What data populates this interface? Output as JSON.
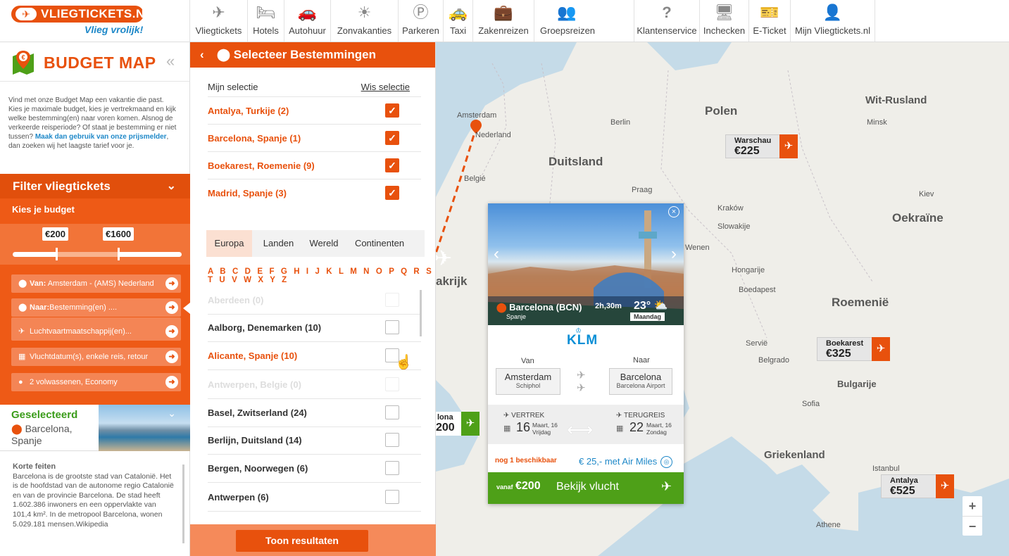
{
  "brand": {
    "name": "VLIEGTICKETS.NL",
    "slogan": "Vlieg vrolijk!"
  },
  "nav": [
    {
      "label": "Vliegtickets",
      "icon": "plane-icon"
    },
    {
      "label": "Hotels",
      "icon": "bed-icon"
    },
    {
      "label": "Autohuur",
      "icon": "car-icon"
    },
    {
      "label": "Zonvakanties",
      "icon": "sun-icon"
    },
    {
      "label": "Parkeren",
      "icon": "parking-icon"
    },
    {
      "label": "Taxi",
      "icon": "taxi-icon"
    },
    {
      "label": "Zakenreizen",
      "icon": "briefcase-icon"
    },
    {
      "label": "Groepsreizen",
      "icon": "group-icon"
    },
    {
      "label": "Klantenservice",
      "icon": "question-icon"
    },
    {
      "label": "Inchecken",
      "icon": "monitor-check-icon"
    },
    {
      "label": "E-Ticket",
      "icon": "ticket-icon"
    },
    {
      "label": "Mijn Vliegtickets.nl",
      "icon": "user-icon"
    }
  ],
  "budget_map": {
    "title": "BUDGET MAP",
    "intro": "Vind met onze Budget Map een vakantie die past. Kies je maximale budget, kies je vertrekmaand en kijk welke bestemming(en) naar voren komen. Alsnog de verkeerde reisperiode? Of staat je bestemming er niet tussen?",
    "intro_link": "Maak dan gebruik van onze prijsmelder",
    "intro_end": ", dan zoeken wij het laagste tarief voor je."
  },
  "filter": {
    "title": "Filter vliegtickets",
    "budget_label": "Kies je budget",
    "min_price": "€200",
    "max_price": "€1600",
    "van_label": "Van:",
    "van_value": "Amsterdam - (AMS) Nederland",
    "naar_label": "Naar:",
    "naar_value": "Bestemming(en) ....",
    "airlines": "Luchtvaartmaatschappij(en)...",
    "dates": "Vluchtdatum(s), enkele reis, retour",
    "passengers": "2 volwassenen, Economy"
  },
  "selected": {
    "title": "Geselecteerd",
    "place": "Barcelona, Spanje"
  },
  "facts": {
    "title": "Korte feiten",
    "text": "Barcelona is de grootste stad van Catalonië. Het is de hoofdstad van de autonome regio Catalonië en van de provincie Barcelona. De stad heeft 1.602.386 inwoners en een oppervlakte van 101,4 km². In de metropool Barcelona, wonen 5.029.181 mensen.Wikipedia"
  },
  "destinations": {
    "title": "Selecteer Bestemmingen",
    "my_selection": "Mijn selectie",
    "clear": "Wis selectie",
    "selected": [
      "Antalya, Turkije (2)",
      "Barcelona, Spanje (1)",
      "Boekarest, Roemenie (9)",
      "Madrid, Spanje (3)"
    ],
    "tabs": [
      "Europa",
      "Landen",
      "Wereld",
      "Continenten"
    ],
    "alphabet": "A B C D E F G H I J K L M N O P Q R S T U V W X Y Z",
    "list": [
      {
        "name": "Aberdeen (0)",
        "state": "faded"
      },
      {
        "name": "Aalborg, Denemarken (10)",
        "state": "normal"
      },
      {
        "name": "Alicante, Spanje (10)",
        "state": "hl"
      },
      {
        "name": "Antwerpen, Belgie (0)",
        "state": "faded"
      },
      {
        "name": "Basel, Zwitserland (24)",
        "state": "normal"
      },
      {
        "name": "Berlijn, Duitsland (14)",
        "state": "normal"
      },
      {
        "name": "Bergen, Noorwegen (6)",
        "state": "normal"
      },
      {
        "name": "Antwerpen (6)",
        "state": "normal"
      }
    ],
    "show_button": "Toon resultaten"
  },
  "map": {
    "countries": [
      "Polen",
      "Wit-Rusland",
      "Duitsland",
      "Oekraïne",
      "Roemenië",
      "Bulgarije",
      "Griekenland",
      "Nederland",
      "Belgié",
      "Slowakije",
      "Hongarije",
      "Servië",
      "akrijk"
    ],
    "cities": [
      "Amsterdam",
      "Berlin",
      "Minsk",
      "Kiev",
      "Kraków",
      "Praag",
      "Wenen",
      "Boedapest",
      "Belgrado",
      "Sofia",
      "Athene",
      "Istanbul"
    ],
    "tags": [
      {
        "name": "Warschau",
        "price": "€225"
      },
      {
        "name": "Boekarest",
        "price": "€325"
      },
      {
        "name": "Antalya",
        "price": "€525"
      }
    ],
    "green_tag": {
      "name": "lona",
      "price": "200"
    },
    "zoom_in": "+",
    "zoom_out": "−"
  },
  "popup": {
    "city": "Barcelona (BCN)",
    "country": "Spanje",
    "duration": "2h,30m",
    "temp": "23°",
    "day": "Maandag",
    "airline": "KLM",
    "from_label": "Van",
    "to_label": "Naar",
    "from_city": "Amsterdam",
    "from_airport": "Schiphol",
    "to_city": "Barcelona",
    "to_airport": "Barcelona Airport",
    "depart_label": "VERTREK",
    "depart_day": "16",
    "depart_month": "Maart, 16",
    "depart_weekday": "Vrijdag",
    "return_label": "TERUGREIS",
    "return_day": "22",
    "return_month": "Maart, 16",
    "return_weekday": "Zondag",
    "availability": "nog 1 beschikbaar",
    "air_miles": "€ 25,- met Air Miles",
    "from_price_label": "vanaf",
    "price": "€200",
    "cta": "Bekijk vlucht"
  },
  "colors": {
    "brand": "#e8510d",
    "green": "#4ea018",
    "link": "#1e88c8",
    "map": "#c5dbe8"
  }
}
